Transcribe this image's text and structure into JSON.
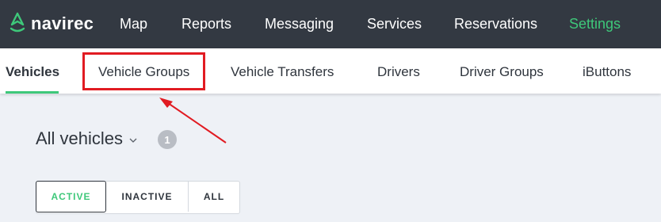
{
  "brand": {
    "name": "navirec",
    "logo_icon": "navirec-pin-icon",
    "accent": "#3ec87a"
  },
  "topnav": {
    "items": [
      {
        "label": "Map",
        "active": false
      },
      {
        "label": "Reports",
        "active": false
      },
      {
        "label": "Messaging",
        "active": false
      },
      {
        "label": "Services",
        "active": false
      },
      {
        "label": "Reservations",
        "active": false
      },
      {
        "label": "Settings",
        "active": true
      }
    ]
  },
  "tabs": {
    "items": [
      {
        "label": "Vehicles",
        "active": true
      },
      {
        "label": "Vehicle Groups",
        "active": false
      },
      {
        "label": "Vehicle Transfers",
        "active": false
      },
      {
        "label": "Drivers",
        "active": false
      },
      {
        "label": "Driver Groups",
        "active": false
      },
      {
        "label": "iButtons",
        "active": false
      }
    ]
  },
  "annotation": {
    "highlight_color": "#e11b22",
    "highlighted_tab": "Vehicle Groups"
  },
  "main": {
    "heading": "All vehicles",
    "heading_icon": "chevron-down-icon",
    "count": "1",
    "filters": [
      {
        "label": "ACTIVE",
        "active": true
      },
      {
        "label": "INACTIVE",
        "active": false
      },
      {
        "label": "ALL",
        "active": false
      }
    ]
  }
}
